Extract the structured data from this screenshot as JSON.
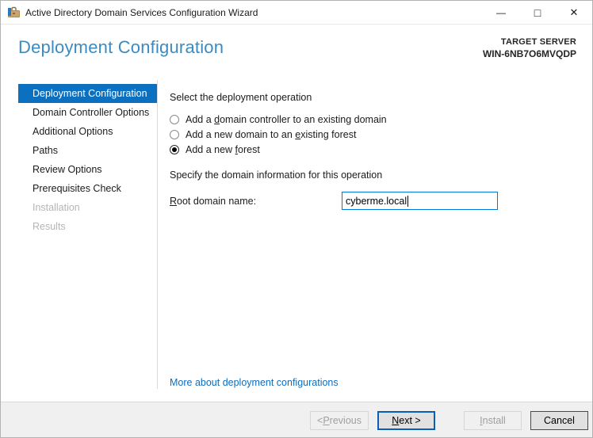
{
  "window": {
    "title": "Active Directory Domain Services Configuration Wizard",
    "controls": {
      "minimize": "—",
      "maximize": "□",
      "close": "✕"
    }
  },
  "header": {
    "title": "Deployment Configuration",
    "target_server_label": "TARGET SERVER",
    "target_server_name": "WIN-6NB7O6MVQDP"
  },
  "sidebar": {
    "items": [
      {
        "label": "Deployment Configuration",
        "state": "selected"
      },
      {
        "label": "Domain Controller Options",
        "state": "enabled"
      },
      {
        "label": "Additional Options",
        "state": "enabled"
      },
      {
        "label": "Paths",
        "state": "enabled"
      },
      {
        "label": "Review Options",
        "state": "enabled"
      },
      {
        "label": "Prerequisites Check",
        "state": "enabled"
      },
      {
        "label": "Installation",
        "state": "disabled"
      },
      {
        "label": "Results",
        "state": "disabled"
      }
    ]
  },
  "main": {
    "operation_section": {
      "heading": "Select the deployment operation",
      "radios": [
        {
          "pre": "Add a ",
          "accel": "d",
          "post": "omain controller to an existing domain",
          "selected": false
        },
        {
          "pre": "Add a new domain to an ",
          "accel": "e",
          "post": "xisting forest",
          "selected": false
        },
        {
          "pre": "Add a new ",
          "accel": "f",
          "post": "orest",
          "selected": true
        }
      ]
    },
    "domain_section": {
      "heading": "Specify the domain information for this operation",
      "field_label_accel": "R",
      "field_label_rest": "oot domain name:",
      "field_value": "cyberme.local"
    },
    "link_text": "More about deployment configurations"
  },
  "footer": {
    "buttons": [
      {
        "pre": "< ",
        "accel": "P",
        "post": "revious",
        "state": "disabled"
      },
      {
        "pre": "",
        "accel": "N",
        "post": "ext >",
        "state": "default"
      },
      {
        "pre": "",
        "accel": "I",
        "post": "nstall",
        "state": "disabled"
      },
      {
        "pre": "",
        "accel": "",
        "post": "Cancel",
        "state": "enabled"
      }
    ]
  },
  "colors": {
    "accent_blue": "#0c70c0",
    "heading_blue": "#3b8bc0",
    "link_blue": "#0f6cbd",
    "input_focus_border": "#0078d7",
    "footer_bg": "#f0f0f0"
  }
}
